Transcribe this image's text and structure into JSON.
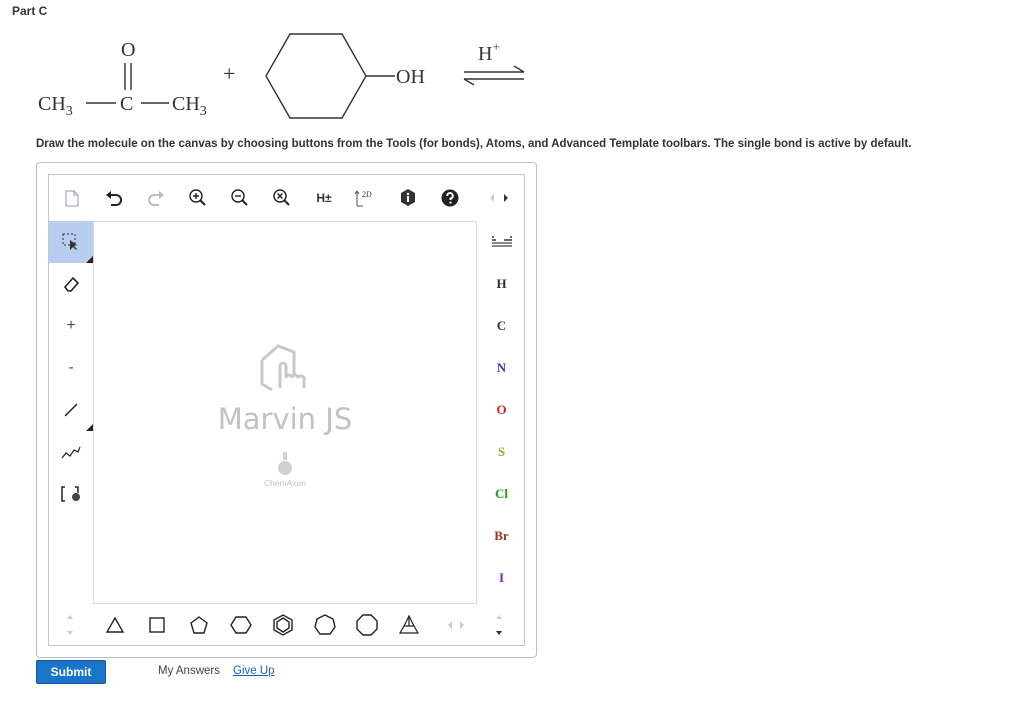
{
  "part_title": "Part C",
  "reaction": {
    "reactant1": {
      "oxygen": "O",
      "left_group": "CH",
      "left_sub": "3",
      "center": "C",
      "right_group": "CH",
      "right_sub": "3"
    },
    "plus": "+",
    "reactant2": {
      "hydroxyl": "OH"
    },
    "catalyst": "H",
    "catalyst_sup": "+"
  },
  "instructions": "Draw the molecule on the canvas by choosing buttons from the Tools (for bonds), Atoms, and Advanced Template toolbars. The single bond is active by default.",
  "editor": {
    "top_toolbar": {
      "h_toggle": "H±",
      "label_2d": "2D"
    },
    "left_toolbar": {
      "plus": "+",
      "minus": "-"
    },
    "atoms": [
      {
        "symbol": "H",
        "color": "#333333"
      },
      {
        "symbol": "C",
        "color": "#333333"
      },
      {
        "symbol": "N",
        "color": "#2a3fb7"
      },
      {
        "symbol": "O",
        "color": "#e02020"
      },
      {
        "symbol": "S",
        "color": "#a5a526"
      },
      {
        "symbol": "Cl",
        "color": "#1f9b1f"
      },
      {
        "symbol": "Br",
        "color": "#8b3a2a"
      },
      {
        "symbol": "I",
        "color": "#8a1fb0"
      }
    ],
    "watermark": {
      "title": "Marvin JS",
      "vendor": "ChemAxon"
    }
  },
  "footer": {
    "submit": "Submit",
    "my_answers": "My Answers",
    "give_up": "Give Up"
  }
}
